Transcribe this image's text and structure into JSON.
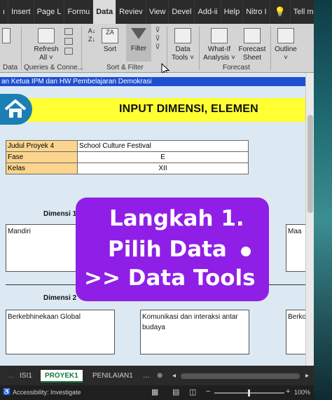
{
  "tabs": [
    {
      "label": "ı"
    },
    {
      "label": "Insert"
    },
    {
      "label": "Page L"
    },
    {
      "label": "Formu"
    },
    {
      "label": "Data",
      "active": true
    },
    {
      "label": "Reviev"
    },
    {
      "label": "View"
    },
    {
      "label": "Devel"
    },
    {
      "label": "Add-ii"
    },
    {
      "label": "Help"
    },
    {
      "label": "Nitro I"
    },
    {
      "label": "💡"
    },
    {
      "label": "Tell me"
    }
  ],
  "ribbon": {
    "refresh_label": "Refresh",
    "refresh_sub": "All ˅",
    "sort_label": "Sort",
    "filter_label": "Filter",
    "data_tools_label": "Data",
    "data_tools_sub": "Tools ˅",
    "whatif_label": "What-If",
    "whatif_sub": "Analysis ˅",
    "forecast_label": "Forecast",
    "forecast_sub": "Sheet",
    "outline_label": "Outline",
    "outline_sub": "˅",
    "group_data": "Data",
    "group_queries": "Queries & Conne...",
    "group_sortfilter": "Sort & Filter",
    "group_forecast": "Forecast"
  },
  "sheet": {
    "banner": "an Ketua IPM dan HW Pembelajaran Demokrasi",
    "title": "INPUT DIMENSI, ELEMEN",
    "rows": [
      {
        "label": "Judul Proyek 4",
        "value": "School Culture Festival"
      },
      {
        "label": "Fase",
        "value": "E"
      },
      {
        "label": "Kelas",
        "value": "XII"
      }
    ],
    "dimensi1": "Dimensi 1",
    "dimensi2": "Dimensi 2",
    "box_mandiri": "Mandiri",
    "box_maa": "Maa",
    "box_berkebhinekaan": "Berkebhinekaan Global",
    "box_komunikasi": "Komunikasi dan interaksi antar budaya",
    "box_berko": "Berko"
  },
  "overlay": {
    "line1": "Langkah 1.",
    "line2": "Pilih Data",
    "line3": ">> Data Tools"
  },
  "sheettabs": [
    {
      "label": "ISI1"
    },
    {
      "label": "PROYEK1",
      "active": true
    },
    {
      "label": "PENILAIAN1"
    }
  ],
  "status": {
    "accessibility": "Accessibility: Investigate",
    "zoom": "100%"
  },
  "colors": {
    "overlay": "#8f1fe6",
    "title_band": "#ffff33",
    "label_fill": "#fbd58d",
    "active_sheet": "#117a3a"
  }
}
